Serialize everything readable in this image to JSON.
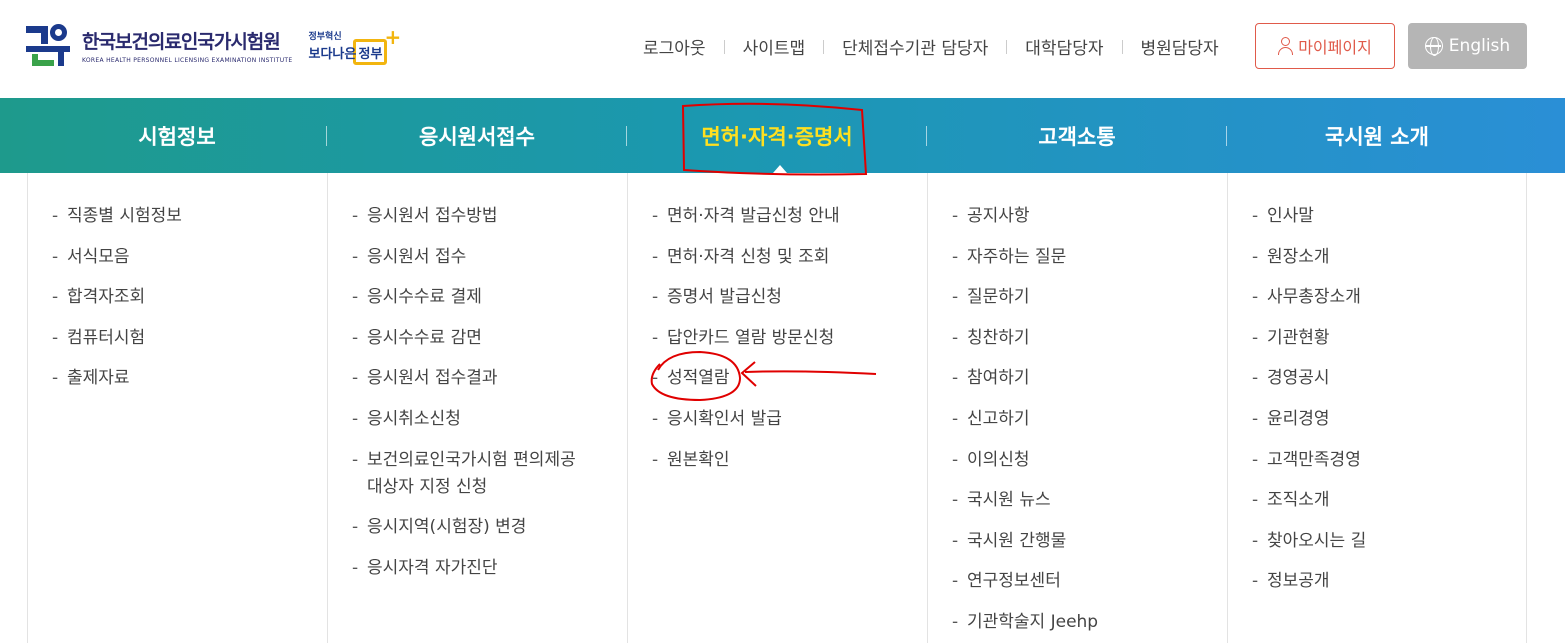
{
  "header": {
    "org_name": "한국보건의료인국가시험원",
    "org_sub": "KOREA HEALTH PERSONNEL LICENSING EXAMINATION INSTITUTE",
    "gov_small": "정부혁신",
    "gov_big": "보다나은",
    "gov_inner": "정부",
    "util_links": [
      "로그아웃",
      "사이트맵",
      "단체접수기관 담당자",
      "대학담당자",
      "병원담당자"
    ],
    "mypage_label": "마이페이지",
    "english_label": "English"
  },
  "nav": {
    "items": [
      {
        "label": "시험정보"
      },
      {
        "label": "응시원서접수"
      },
      {
        "label": "면허·자격·증명서"
      },
      {
        "label": "고객소통"
      },
      {
        "label": "국시원 소개"
      }
    ],
    "active_index": 2
  },
  "submenu": {
    "columns": [
      [
        "직종별 시험정보",
        "서식모음",
        "합격자조회",
        "컴퓨터시험",
        "출제자료"
      ],
      [
        "응시원서 접수방법",
        "응시원서 접수",
        "응시수수료 결제",
        "응시수수료 감면",
        "응시원서 접수결과",
        "응시취소신청",
        "보건의료인국가시험 편의제공 대상자 지정 신청",
        "응시지역(시험장) 변경",
        "응시자격 자가진단"
      ],
      [
        "면허·자격 발급신청 안내",
        "면허·자격 신청 및 조회",
        "증명서 발급신청",
        "답안카드 열람 방문신청",
        "성적열람",
        "응시확인서 발급",
        "원본확인"
      ],
      [
        "공지사항",
        "자주하는 질문",
        "질문하기",
        "칭찬하기",
        "참여하기",
        "신고하기",
        "이의신청",
        "국시원 뉴스",
        "국시원 간행물",
        "연구정보센터",
        "기관학술지 Jeehp"
      ],
      [
        "인사말",
        "원장소개",
        "사무총장소개",
        "기관현황",
        "경영공시",
        "윤리경영",
        "고객만족경영",
        "조직소개",
        "찾아오시는 길",
        "정보공개"
      ]
    ]
  },
  "colors": {
    "accent_red": "#e05a4a",
    "nav_start": "#1e9a8c",
    "nav_end": "#2a8fd6",
    "active_yellow": "#ffe01f",
    "annotation_red": "#e00000"
  }
}
